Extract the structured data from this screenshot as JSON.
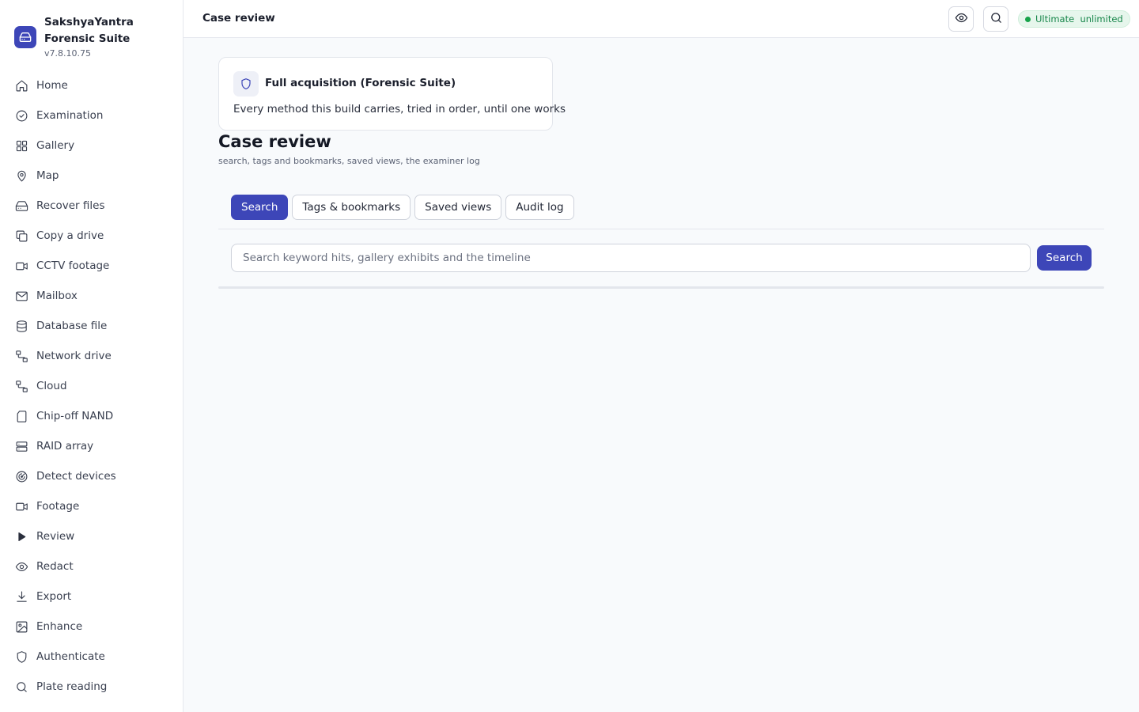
{
  "app": {
    "name": "SakshyaYantra Forensic Suite",
    "version": "v7.8.10.75",
    "accent_color": "#3d46b8"
  },
  "sidebar": {
    "items": [
      {
        "label": "Home",
        "icon": "home-icon"
      },
      {
        "label": "Examination",
        "icon": "check-circle-icon"
      },
      {
        "label": "Gallery",
        "icon": "grid-icon"
      },
      {
        "label": "Map",
        "icon": "map-pin-icon"
      },
      {
        "label": "Recover files",
        "icon": "hard-drive-icon"
      },
      {
        "label": "Copy a drive",
        "icon": "copy-icon"
      },
      {
        "label": "CCTV footage",
        "icon": "video-icon"
      },
      {
        "label": "Mailbox",
        "icon": "mail-icon"
      },
      {
        "label": "Database file",
        "icon": "database-icon"
      },
      {
        "label": "Network drive",
        "icon": "network-icon"
      },
      {
        "label": "Cloud",
        "icon": "network-icon"
      },
      {
        "label": "Chip-off NAND",
        "icon": "sd-card-icon"
      },
      {
        "label": "RAID array",
        "icon": "server-icon"
      },
      {
        "label": "Detect devices",
        "icon": "radar-icon"
      },
      {
        "label": "Footage",
        "icon": "video-icon"
      },
      {
        "label": "Review",
        "icon": "play-icon"
      },
      {
        "label": "Redact",
        "icon": "eye-icon"
      },
      {
        "label": "Export",
        "icon": "download-icon"
      },
      {
        "label": "Enhance",
        "icon": "image-icon"
      },
      {
        "label": "Authenticate",
        "icon": "shield-icon"
      },
      {
        "label": "Plate reading",
        "icon": "search-icon"
      }
    ]
  },
  "topbar": {
    "title": "Case review",
    "license_label": "Ultimate  unlimited",
    "license_color": "#16a34a"
  },
  "method_card": {
    "title": "Full acquisition (Forensic Suite)",
    "description": "Every method this build carries, tried in order, until one works"
  },
  "page": {
    "title": "Case review",
    "subtitle": "search, tags and bookmarks, saved views, the examiner log"
  },
  "tabs": [
    {
      "label": "Search",
      "active": true
    },
    {
      "label": "Tags & bookmarks",
      "active": false
    },
    {
      "label": "Saved views",
      "active": false
    },
    {
      "label": "Audit log",
      "active": false
    }
  ],
  "search": {
    "value": "",
    "placeholder": "Search keyword hits, gallery exhibits and the timeline",
    "button_label": "Search"
  }
}
